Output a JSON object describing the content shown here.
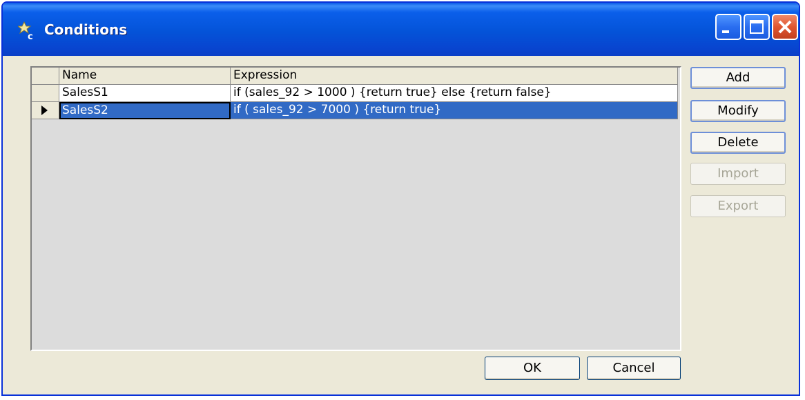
{
  "window": {
    "title": "Conditions",
    "icon": "conditions-icon",
    "controls": {
      "minimize": "minimize-icon",
      "maximize": "maximize-icon",
      "close": "close-icon"
    }
  },
  "grid": {
    "columns": [
      "Name",
      "Expression"
    ],
    "rows": [
      {
        "name": "SalesS1",
        "expression": "if (sales_92 > 1000 ) {return true} else {return false}",
        "selected": false
      },
      {
        "name": "SalesS2",
        "expression": "if ( sales_92 > 7000 ) {return true}",
        "selected": true
      }
    ]
  },
  "side_buttons": {
    "add": "Add",
    "modify": "Modify",
    "delete": "Delete",
    "import": "Import",
    "export": "Export"
  },
  "footer": {
    "ok": "OK",
    "cancel": "Cancel"
  },
  "colors": {
    "title_bar": "#0453d8",
    "selection": "#316ac5",
    "dialog_bg": "#ece9d8",
    "grid_bg": "#dcdcdc"
  }
}
